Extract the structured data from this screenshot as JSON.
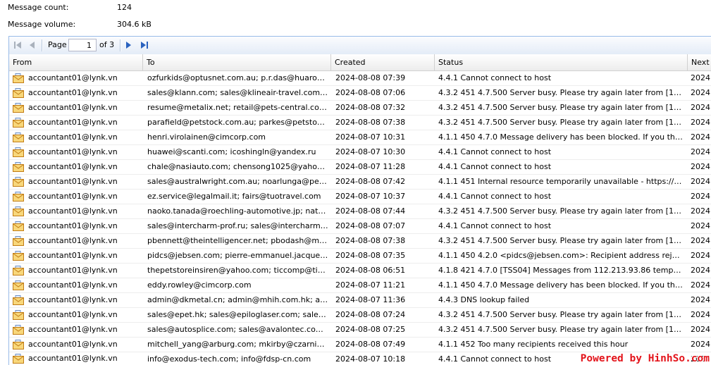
{
  "summary": {
    "count": {
      "label": "Message count:",
      "value": "124"
    },
    "volume": {
      "label": "Message volume:",
      "value": "304.6 kB"
    }
  },
  "pager": {
    "page_label": "Page",
    "current_page": "1",
    "of_total": "of 3"
  },
  "icons": {
    "first_page": "first-page-icon",
    "previous_page": "prev-page-icon",
    "next_page": "next-page-icon",
    "last_page": "last-page-icon",
    "message": "envelope-icon"
  },
  "colors": {
    "accent_border": "#99bbe8",
    "nav_enabled": "#2a62bf",
    "nav_disabled": "#a9b1bc",
    "watermark": "#e3141b"
  },
  "grid": {
    "columns": {
      "from": "From",
      "to": "To",
      "created": "Created",
      "status": "Status",
      "next": "Next"
    },
    "rows": [
      {
        "from": "accountant01@lynk.vn",
        "to": "ozfurkids@optusnet.com.au; p.r.das@huaro…",
        "created": "2024-08-08 07:39",
        "status": "4.4.1 Cannot connect to host",
        "next": "2024"
      },
      {
        "from": "accountant01@lynk.vn",
        "to": "sales@klann.com; sales@klineair-travel.com…",
        "created": "2024-08-08 07:06",
        "status": "4.3.2 451 4.7.500 Server busy. Please try again later from [1…",
        "next": "2024"
      },
      {
        "from": "accountant01@lynk.vn",
        "to": "resume@metalix.net; retail@pets-central.co…",
        "created": "2024-08-08 07:32",
        "status": "4.3.2 451 4.7.500 Server busy. Please try again later from [1…",
        "next": "2024"
      },
      {
        "from": "accountant01@lynk.vn",
        "to": "parafield@petstock.com.au; parkes@petsto…",
        "created": "2024-08-08 07:38",
        "status": "4.3.2 451 4.7.500 Server busy. Please try again later from [1…",
        "next": "2024"
      },
      {
        "from": "accountant01@lynk.vn",
        "to": "henri.virolainen@cimcorp.com",
        "created": "2024-08-07 10:31",
        "status": "4.1.1 450 4.7.0 Message delivery has been blocked. If you th…",
        "next": "2024"
      },
      {
        "from": "accountant01@lynk.vn",
        "to": "huawei@scanti.com; icoshingln@yandex.ru",
        "created": "2024-08-07 10:30",
        "status": "4.4.1 Cannot connect to host",
        "next": "2024"
      },
      {
        "from": "accountant01@lynk.vn",
        "to": "chale@nasiauto.com; chensong1025@yaho…",
        "created": "2024-08-07 11:28",
        "status": "4.4.1 Cannot connect to host",
        "next": "2024"
      },
      {
        "from": "accountant01@lynk.vn",
        "to": "sales@australwright.com.au; noarlunga@pe…",
        "created": "2024-08-08 07:42",
        "status": "4.1.1 451 Internal resource temporarily unavailable - https://…",
        "next": "2024"
      },
      {
        "from": "accountant01@lynk.vn",
        "to": "ez.service@legalmail.it; fairs@tuotravel.com",
        "created": "2024-08-07 10:37",
        "status": "4.4.1 Cannot connect to host",
        "next": "2024"
      },
      {
        "from": "accountant01@lynk.vn",
        "to": "naoko.tanada@roechling-automotive.jp; nat…",
        "created": "2024-08-08 07:44",
        "status": "4.3.2 451 4.7.500 Server busy. Please try again later from [1…",
        "next": "2024"
      },
      {
        "from": "accountant01@lynk.vn",
        "to": "sales@intercharm-prof.ru; sales@intercharm…",
        "created": "2024-08-08 07:07",
        "status": "4.4.1 Cannot connect to host",
        "next": "2024"
      },
      {
        "from": "accountant01@lynk.vn",
        "to": "pbennett@theintelligencer.net; pbodash@m…",
        "created": "2024-08-08 07:38",
        "status": "4.3.2 451 4.7.500 Server busy. Please try again later from [1…",
        "next": "2024"
      },
      {
        "from": "accountant01@lynk.vn",
        "to": "pidcs@jebsen.com; pierre-emmanuel.jacque…",
        "created": "2024-08-08 07:35",
        "status": "4.1.1 450 4.2.0 <pidcs@jebsen.com>: Recipient address rej…",
        "next": "2024"
      },
      {
        "from": "accountant01@lynk.vn",
        "to": "thepetstoreinsiren@yahoo.com; ticcomp@ti…",
        "created": "2024-08-08 06:51",
        "status": "4.1.8 421 4.7.0 [TSS04] Messages from 112.213.93.86 temp…",
        "next": "2024"
      },
      {
        "from": "accountant01@lynk.vn",
        "to": "eddy.rowley@cimcorp.com",
        "created": "2024-08-07 11:21",
        "status": "4.1.1 450 4.7.0 Message delivery has been blocked. If you th…",
        "next": "2024"
      },
      {
        "from": "accountant01@lynk.vn",
        "to": "admin@dkmetal.cn; admin@mhih.com.hk; a…",
        "created": "2024-08-07 11:36",
        "status": "4.4.3 DNS lookup failed",
        "next": "2024"
      },
      {
        "from": "accountant01@lynk.vn",
        "to": "sales@epet.hk; sales@epiloglaser.com; sale…",
        "created": "2024-08-08 07:24",
        "status": "4.3.2 451 4.7.500 Server busy. Please try again later from [1…",
        "next": "2024"
      },
      {
        "from": "accountant01@lynk.vn",
        "to": "sales@autosplice.com; sales@avalontec.co…",
        "created": "2024-08-08 07:25",
        "status": "4.3.2 451 4.7.500 Server busy. Please try again later from [1…",
        "next": "2024"
      },
      {
        "from": "accountant01@lynk.vn",
        "to": "mitchell_yang@arburg.com; mkirby@czarni…",
        "created": "2024-08-08 07:49",
        "status": "4.1.1 452 Too many recipients received this hour",
        "next": "2024"
      },
      {
        "from": "accountant01@lynk.vn",
        "to": "info@exodus-tech.com; info@fdsp-cn.com",
        "created": "2024-08-07 10:18",
        "status": "4.4.1 Cannot connect to host",
        "next": "2024"
      }
    ]
  },
  "watermark": "Powered by HinhSo.com"
}
